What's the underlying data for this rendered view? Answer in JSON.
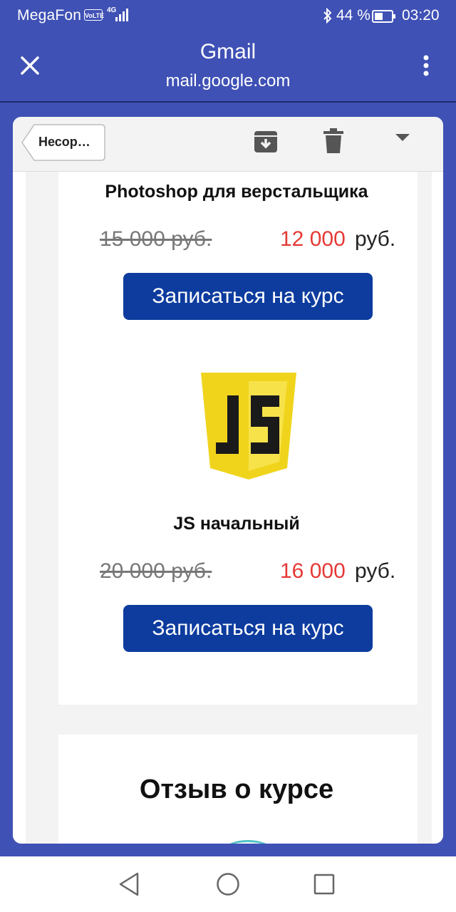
{
  "status_bar": {
    "carrier": "MegaFon",
    "volte": "VoLTE",
    "network": "4G",
    "battery": "44 %",
    "time": "03:20",
    "icons": [
      "signal-icon",
      "bluetooth-icon",
      "battery-icon"
    ]
  },
  "app_bar": {
    "title": "Gmail",
    "subtitle": "mail.google.com",
    "icons": [
      "close-icon",
      "more-vert-icon"
    ]
  },
  "toolbar": {
    "label": "Несор…",
    "icons": [
      "archive-icon",
      "delete-icon",
      "dropdown-arrow-icon"
    ]
  },
  "courses": [
    {
      "title": "Photoshop для верстальщика",
      "old_price": "15 000 руб.",
      "new_price": "12 000",
      "currency": "руб.",
      "button": "Записаться на курс"
    },
    {
      "title": "JS начальный",
      "logo_text": "JS",
      "old_price": "20 000 руб.",
      "new_price": "16 000",
      "currency": "руб.",
      "button": "Записаться на курс"
    }
  ],
  "review": {
    "title": "Отзыв о курсе"
  },
  "nav_bar": {
    "icons": [
      "back-icon",
      "home-icon",
      "recents-icon"
    ]
  },
  "colors": {
    "app_bar": "#3f51b5",
    "button": "#0d3c9e",
    "price_new": "#e53935",
    "js_logo": "#f0d41c"
  }
}
